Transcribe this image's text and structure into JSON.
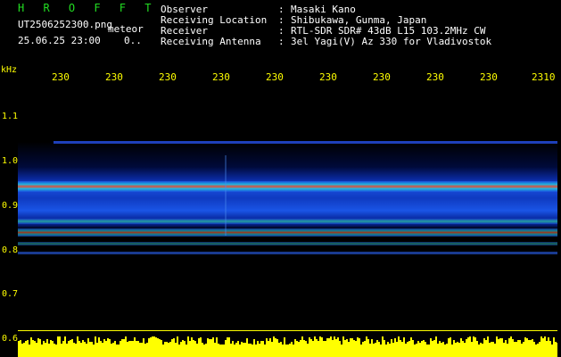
{
  "app": {
    "title": "H R O F F T"
  },
  "file": {
    "name": "UT2506252300.png",
    "tag": "meteor",
    "datetime": "25.06.25 23:00",
    "count": "0.."
  },
  "info": [
    {
      "label": "Observer",
      "value": "Masaki Kano"
    },
    {
      "label": "Receiving Location",
      "value": "Shibukawa, Gunma, Japan"
    },
    {
      "label": "Receiver",
      "value": "RTL-SDR SDR# 43dB L15 103.2MHz CW"
    },
    {
      "label": "Receiving Antenna",
      "value": "3el Yagi(V) Az 330 for Vladivostok"
    }
  ],
  "axis": {
    "unit": "kHz",
    "x_ticks": [
      "230",
      "230",
      "230",
      "230",
      "230",
      "230",
      "230",
      "230",
      "230",
      "2310"
    ],
    "y_ticks": [
      "1.1",
      "1.0",
      "0.9",
      "0.8",
      "0.7",
      "0.6"
    ]
  },
  "colors": {
    "label": "#ffff00",
    "title": "#22dd22",
    "text": "#ffffff",
    "bg": "#000000"
  }
}
